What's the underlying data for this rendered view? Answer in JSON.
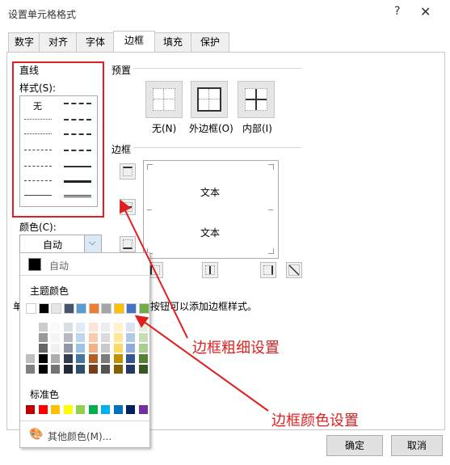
{
  "window": {
    "title": "设置单元格格式",
    "help_label": "?",
    "close_label": "✕"
  },
  "tabs": [
    {
      "label": "数字"
    },
    {
      "label": "对齐"
    },
    {
      "label": "字体"
    },
    {
      "label": "边框",
      "active": true
    },
    {
      "label": "填充"
    },
    {
      "label": "保护"
    }
  ],
  "line_group": {
    "title": "直线",
    "style_label": "样式(S):",
    "none_label": "无"
  },
  "color_group": {
    "label": "颜色(C):",
    "value": "自动"
  },
  "preset_group": {
    "title": "预置",
    "buttons": [
      {
        "label": "无(N)"
      },
      {
        "label": "外边框(O)"
      },
      {
        "label": "内部(I)"
      }
    ]
  },
  "border_group": {
    "title": "边框",
    "preview_text_top": "文本",
    "preview_text_bottom": "文本"
  },
  "hint": {
    "prefix": "单",
    "suffix": "按钮可以添加边框样式。"
  },
  "color_dropdown": {
    "auto_label": "自动",
    "theme_label": "主题颜色",
    "standard_label": "标准色",
    "more_label": "其他颜色(M)...",
    "theme_colors": [
      "#ffffff",
      "#000000",
      "#e7e6e6",
      "#44546a",
      "#5b9bd5",
      "#ed7d31",
      "#a5a5a5",
      "#ffc000",
      "#4472c4",
      "#70ad47"
    ],
    "standard_colors": [
      "#c00000",
      "#ff0000",
      "#ffc000",
      "#ffff00",
      "#92d050",
      "#00b050",
      "#00b0f0",
      "#0070c0",
      "#002060",
      "#7030a0"
    ]
  },
  "annotations": {
    "thickness": "边框粗细设置",
    "color": "边框颜色设置"
  },
  "footer": {
    "ok_label": "确定",
    "cancel_label": "取消"
  },
  "accent_color": "#e02020"
}
